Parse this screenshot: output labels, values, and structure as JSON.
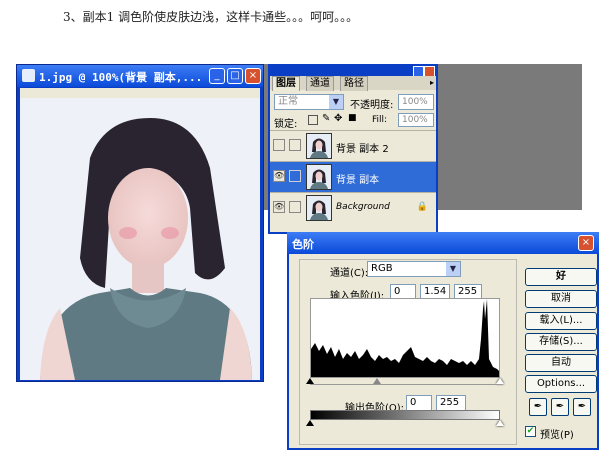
{
  "caption": "3、副本1 调色阶使皮肤边浅，这样卡通些。。。呵呵。。。",
  "image_window": {
    "title": "1.jpg @ 100%(背景 副本,...",
    "min": "_",
    "max": "□",
    "close": "×"
  },
  "layers_panel": {
    "tabs": [
      "图层",
      "通道",
      "路径"
    ],
    "blend_mode": "正常",
    "opacity_label": "不透明度:",
    "opacity_value": "100%",
    "lock_label": "锁定:",
    "fill_label": "Fill:",
    "fill_value": "100%",
    "layers": [
      {
        "name": "背景 副本 2",
        "visible": false,
        "selected": false
      },
      {
        "name": "背景 副本",
        "visible": true,
        "selected": true
      },
      {
        "name": "Background",
        "visible": true,
        "selected": false
      }
    ]
  },
  "levels_dialog": {
    "title": "色阶",
    "channel_label": "通道(C):",
    "channel_value": "RGB",
    "input_label": "输入色阶(I):",
    "input_black": "0",
    "input_gamma": "1.54",
    "input_white": "255",
    "output_label": "输出色阶(O):",
    "output_black": "0",
    "output_white": "255",
    "buttons": {
      "ok": "好",
      "cancel": "取消",
      "load": "载入(L)...",
      "save": "存储(S)...",
      "auto": "自动",
      "options": "Options..."
    },
    "preview_label": "预览(P)",
    "preview_checked": true
  },
  "colors": {
    "titlebar": "#0a4ad8",
    "selected_layer": "#2f6cd8",
    "dialog_bg": "#ece9d8",
    "close_button": "#d8512f"
  }
}
